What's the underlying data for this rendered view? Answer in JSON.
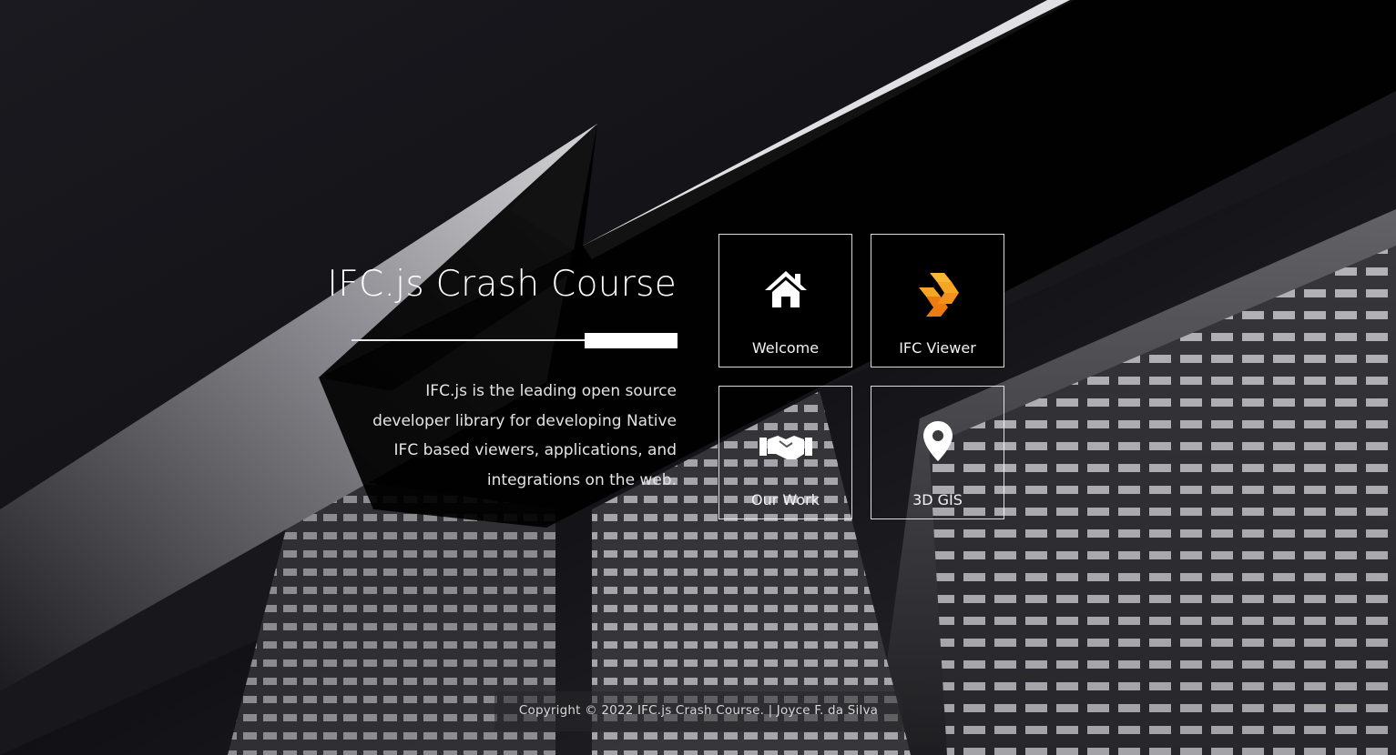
{
  "page": {
    "title": "IFC.js Crash Course",
    "description": "IFC.js is the leading open source developer library for developing Native IFC based viewers, applications, and integrations on the web."
  },
  "tiles": [
    {
      "label": "Welcome",
      "icon": "home-icon"
    },
    {
      "label": "IFC Viewer",
      "icon": "ifcjs-logo-icon"
    },
    {
      "label": "Our Work",
      "icon": "handshake-icon"
    },
    {
      "label": "3D GIS",
      "icon": "map-pin-icon"
    }
  ],
  "footer": {
    "text": "Copyright © 2022 IFC.js Crash Course. | Joyce F. da Silva"
  },
  "colors": {
    "accent_orange": "#f5a623",
    "accent_orange_dark": "#ee7b10",
    "panel_black": "#000000"
  }
}
